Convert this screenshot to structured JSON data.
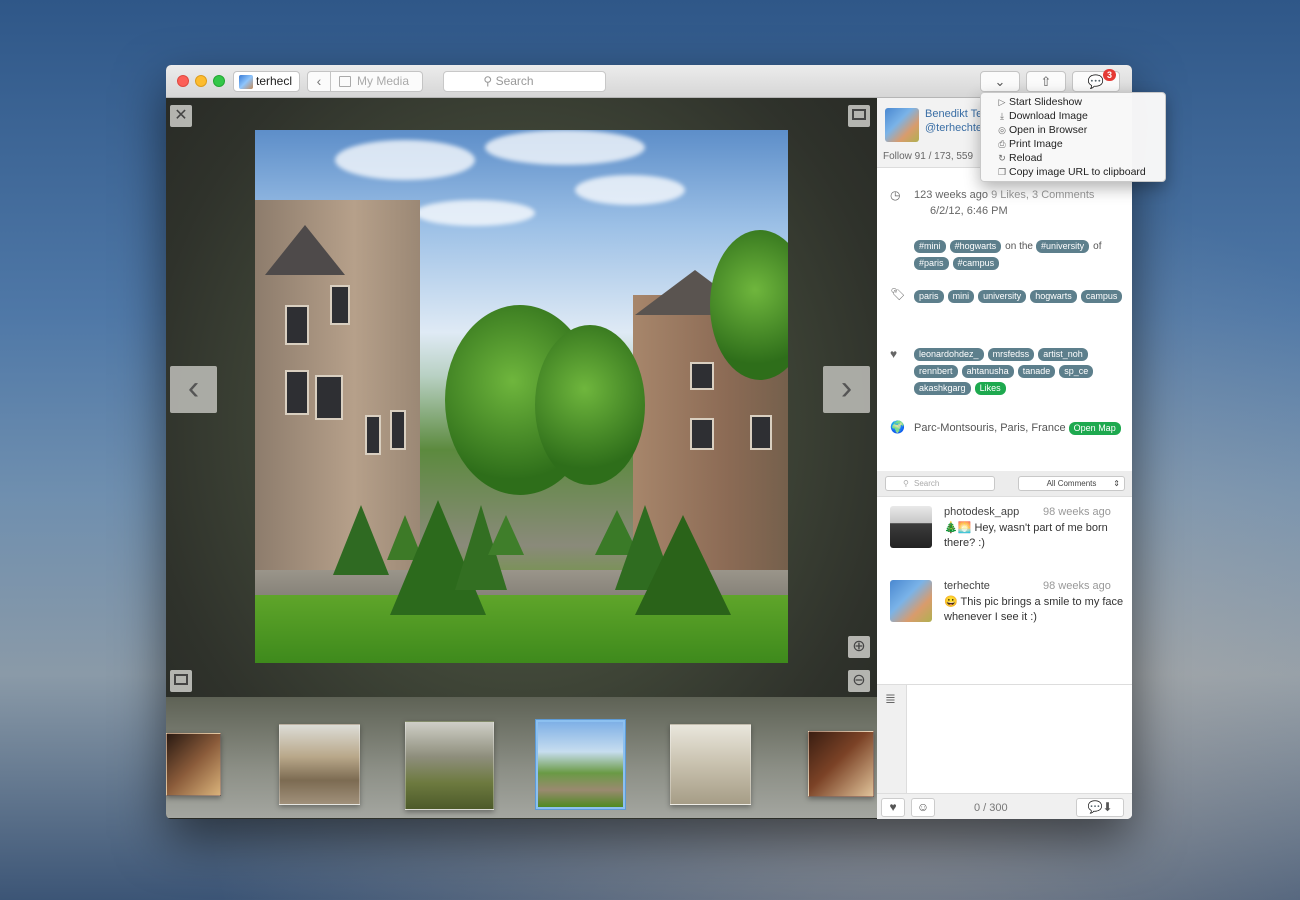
{
  "titlebar": {
    "account_label": "terhecl",
    "back_glyph": "‹",
    "media_label": "My Media",
    "search_placeholder": "Search",
    "comments_badge": "3"
  },
  "menu": {
    "items": [
      {
        "icon": "play-icon",
        "glyph": "▷",
        "label": "Start Slideshow"
      },
      {
        "icon": "download-icon",
        "glyph": "⤓",
        "label": "Download Image"
      },
      {
        "icon": "compass-icon",
        "glyph": "◎",
        "label": "Open in Browser"
      },
      {
        "icon": "printer-icon",
        "glyph": "⎙",
        "label": "Print Image"
      },
      {
        "icon": "reload-icon",
        "glyph": "↻",
        "label": "Reload"
      },
      {
        "icon": "clipboard-icon",
        "glyph": "❐",
        "label": "Copy image URL to clipboard"
      }
    ]
  },
  "viewer": {
    "prev_glyph": "‹",
    "next_glyph": "›",
    "close_glyph": "✕"
  },
  "profile": {
    "name": "Benedikt Te",
    "handle": "@terhechte",
    "follow": "Follow 91 / 173, 559"
  },
  "photo_info": {
    "time_ago": "123 weeks ago",
    "likes_comments": "9 Likes, 3 Comments",
    "date": "6/2/12, 6:46 PM",
    "caption": {
      "tags_a": [
        "#mini",
        "#hogwarts"
      ],
      "on_the": "on the",
      "tag_b": "#university",
      "of": "of",
      "tags_c": [
        "#paris",
        "#campus"
      ]
    },
    "tags": [
      "paris",
      "mini",
      "university",
      "hogwarts",
      "campus"
    ],
    "likers": [
      "leonardohdez_",
      "mrsfedss",
      "artist_noh",
      "rennbert",
      "ahtanusha",
      "tanade",
      "sp_ce",
      "akashkgarg"
    ],
    "likes_button": "Likes",
    "location": "Parc-Montsouris, Paris, France",
    "open_map": "Open Map"
  },
  "comments": {
    "search_placeholder": "Search",
    "filter": "All Comments",
    "items": [
      {
        "user": "photodesk_app",
        "time": "98 weeks ago",
        "text": "🎄🌅 Hey, wasn't part of me born there? :)"
      },
      {
        "user": "terhechte",
        "time": "98 weeks ago",
        "text": "😀 This pic brings a smile to my face whenever I see it :)"
      }
    ],
    "counter": "0 / 300"
  },
  "colors": {
    "tag": "#5d7f8c",
    "tag_green": "#1ea94f",
    "link": "#3a6ea5",
    "badge": "#e53a35",
    "selected_thumb": "#8cc0f0"
  }
}
